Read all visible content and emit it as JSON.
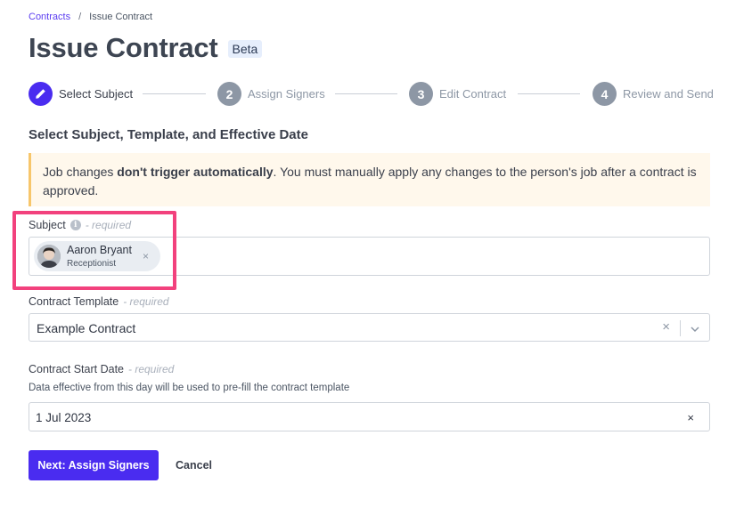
{
  "breadcrumb": {
    "parent": "Contracts",
    "separator": "/",
    "current": "Issue Contract"
  },
  "header": {
    "title": "Issue Contract",
    "badge": "Beta"
  },
  "stepper": {
    "steps": [
      {
        "number": "",
        "label": "Select Subject",
        "state": "active",
        "icon": "pencil-icon"
      },
      {
        "number": "2",
        "label": "Assign Signers",
        "state": "inactive"
      },
      {
        "number": "3",
        "label": "Edit Contract",
        "state": "inactive"
      },
      {
        "number": "4",
        "label": "Review and Send",
        "state": "inactive"
      }
    ]
  },
  "section": {
    "heading": "Select Subject, Template, and Effective Date"
  },
  "notice": {
    "prefix": "Job changes ",
    "bold": "don't trigger automatically",
    "suffix": ". You must manually apply any changes to the person's job after a contract is approved."
  },
  "subject": {
    "label": "Subject",
    "required": "- required",
    "info_icon": "i",
    "chip": {
      "name": "Aaron Bryant",
      "role": "Receptionist",
      "remove": "×"
    }
  },
  "template": {
    "label": "Contract Template",
    "required": "- required",
    "value": "Example Contract",
    "clear": "×"
  },
  "start_date": {
    "label": "Contract Start Date",
    "required": "- required",
    "helper": "Data effective from this day will be used to pre-fill the contract template",
    "value": "1 Jul 2023",
    "clear": "×"
  },
  "actions": {
    "next_label": "Next: Assign Signers",
    "cancel_label": "Cancel"
  },
  "colors": {
    "accent": "#4a2cf0",
    "highlight": "#f2417d",
    "notice_bg": "#fff8ec",
    "notice_border": "#f7c66b"
  }
}
